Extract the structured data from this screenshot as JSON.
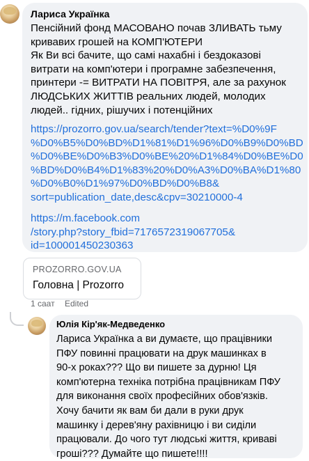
{
  "comment1": {
    "author": "Лариса Українка",
    "text": "Пенсійний фонд МАСОВАНО почав ЗЛИВАТЬ тьму\nкривавих грошей на КОМП'ЮТЕРИ\nЯк Ви всі бачите, що самі нахабні і бездоказові\nвитрати на комп'ютери і програмне забезпечення,\nпринтери -= ВИТРАТИ НА ПОВІТРЯ, але за рахунок\nЛЮДСЬКИХ ЖИТТІВ реальних людей, молодих\nлюдей.. гідних, рішучих і потенційних",
    "link1": "https://prozorro.gov.ua/search/tender?text=%D0%9F\n%D0%B5%D0%BD%D1%81%D1%96%D0%B9%D0%BD\n%D0%BE%D0%B3%D0%BE%20%D1%84%D0%BE%D0\n%BD%D0%B4%D1%83%20%D0%A3%D0%BA%D1%80\n%D0%B0%D1%97%D0%BD%D0%B8&\nsort=publication_date,desc&cpv=30210000-4",
    "link2": "https://m.facebook.com\n/story.php?story_fbid=7176572319067705&\nid=100001450230363",
    "preview_domain": "PROZORRO.GOV.UA",
    "preview_title": "Головна | Prozorro",
    "time": "1 саат",
    "edited": "Edited"
  },
  "comment2": {
    "author": "Юлія Кір'як-Медведенко",
    "text": "Лариса Українка а ви думаєте, що працівники\nПФУ повинні працювати на друк машинках в\n90-х роках??? Що ви пишете за дурню! Ця\nкомп'ютерна техніка потрібна працівникам ПФУ\nдля виконання своїх професійних обов'язків.\nХочу бачити як вам би дали в руки друк\nмашинку і дерев'яну рахівницю і ви сиділи\nпрацювали. До чого тут людські життя, криваві\nгроші??? Думайте що пишете!!!!"
  }
}
